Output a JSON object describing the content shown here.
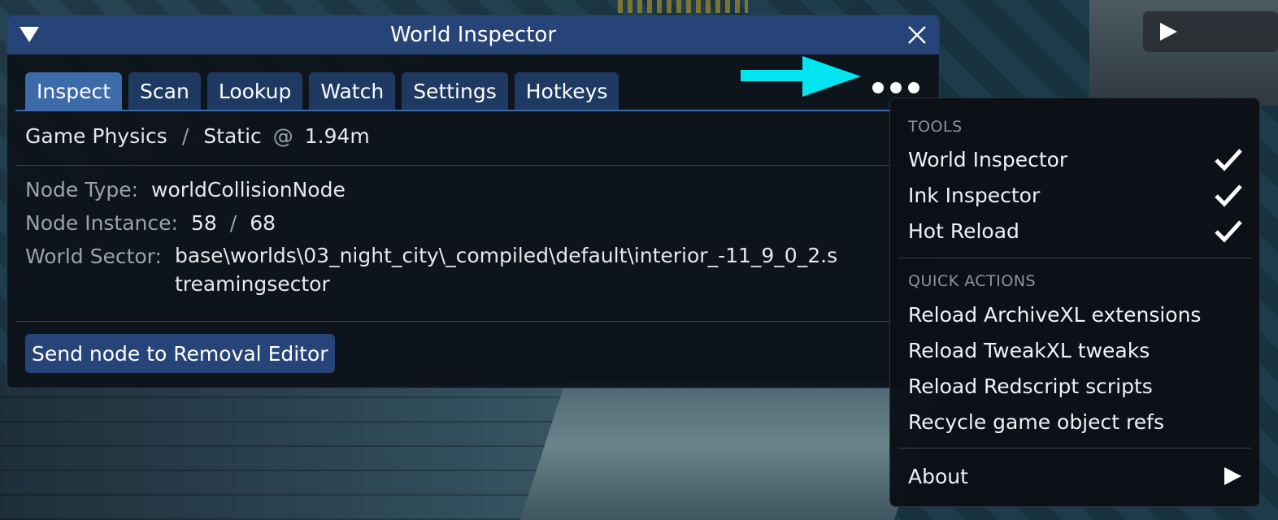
{
  "window": {
    "title": "World Inspector",
    "tabs": [
      "Inspect",
      "Scan",
      "Lookup",
      "Watch",
      "Settings",
      "Hotkeys"
    ],
    "active_tab": "Inspect"
  },
  "breadcrumb": {
    "source": "Game Physics",
    "separator": "/",
    "type": "Static",
    "at": "@",
    "distance": "1.94m"
  },
  "properties": {
    "node_type_label": "Node Type:",
    "node_type_value": "worldCollisionNode",
    "node_instance_label": "Node Instance:",
    "node_instance_current": "58",
    "node_instance_separator": "/",
    "node_instance_total": "68",
    "world_sector_label": "World Sector:",
    "world_sector_value": "base\\worlds\\03_night_city\\_compiled\\default\\interior_-11_9_0_2.streamingsector"
  },
  "actions": {
    "send_to_removal": "Send node to Removal Editor"
  },
  "menu": {
    "tools_header": "TOOLS",
    "tools": [
      {
        "label": "World Inspector",
        "checked": true
      },
      {
        "label": "Ink Inspector",
        "checked": true
      },
      {
        "label": "Hot Reload",
        "checked": true
      }
    ],
    "quick_actions_header": "QUICK ACTIONS",
    "quick_actions": [
      "Reload ArchiveXL extensions",
      "Reload TweakXL tweaks",
      "Reload Redscript scripts",
      "Recycle game object refs"
    ],
    "about": "About"
  },
  "colors": {
    "titlebar": "#264478",
    "active_tab": "#3d6aa8",
    "tab": "#1e3a63",
    "annotation_arrow": "#00e5f0"
  }
}
